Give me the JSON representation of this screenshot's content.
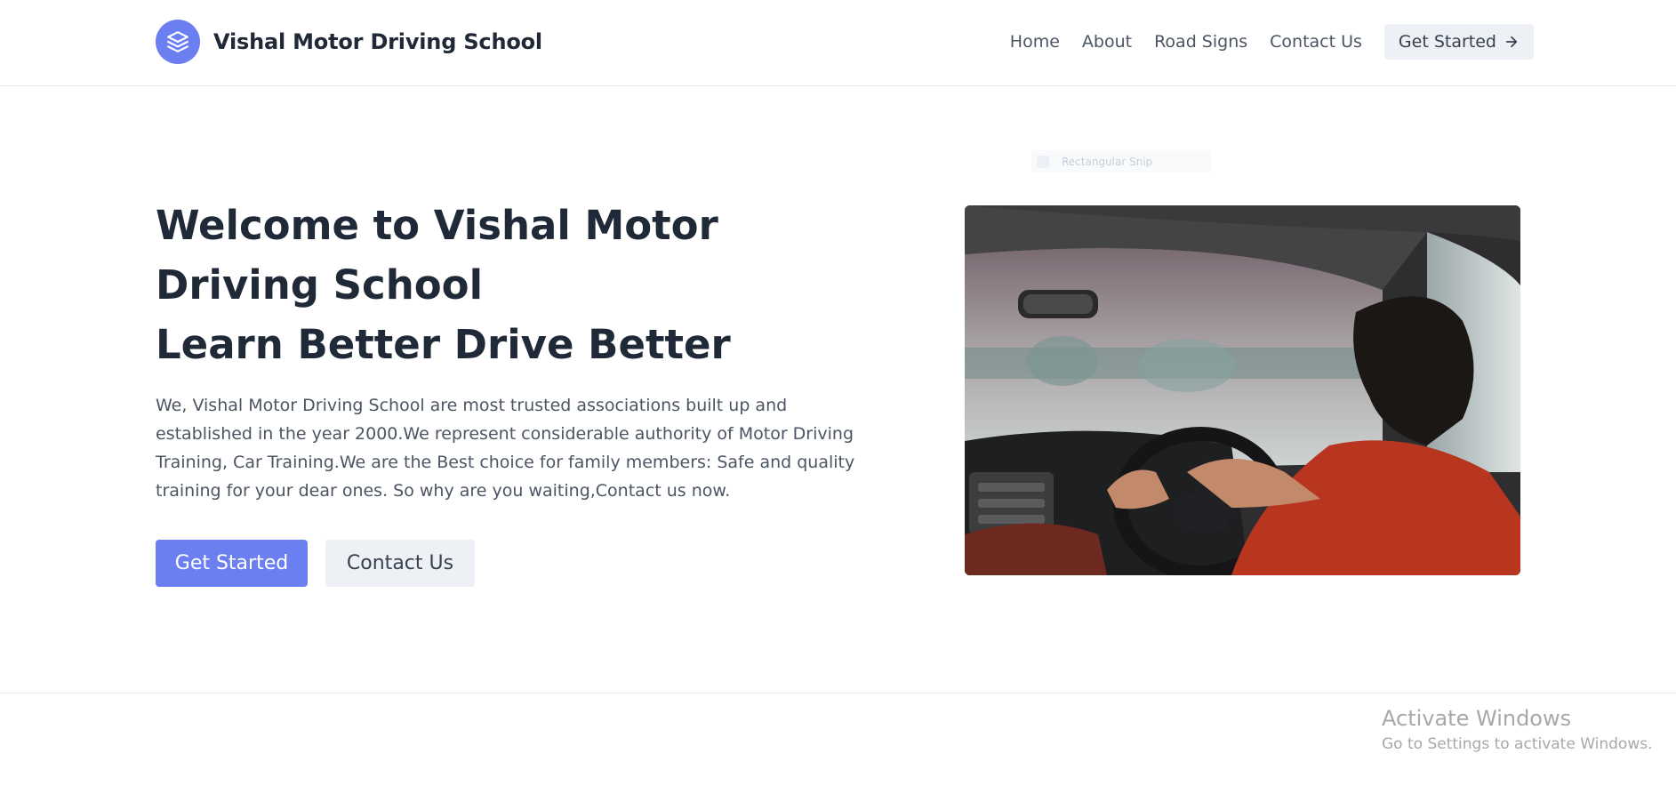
{
  "header": {
    "brand_name": "Vishal Motor Driving School",
    "logo_icon": "layers-icon",
    "nav": [
      {
        "label": "Home"
      },
      {
        "label": "About"
      },
      {
        "label": "Road Signs"
      },
      {
        "label": "Contact Us"
      }
    ],
    "cta_label": "Get Started",
    "cta_icon": "arrow-right-icon"
  },
  "ghost_tooltip": {
    "label": "Rectangular Snip"
  },
  "hero": {
    "title_line1": "Welcome to Vishal Motor Driving School",
    "title_line2": "Learn Better Drive Better",
    "description": "We, Vishal Motor Driving School are most trusted associations built up and established in the year 2000.We represent considerable authority of Motor Driving Training, Car Training.We are the Best choice for family members: Safe and quality training for your dear ones. So why are you waiting,Contact us now.",
    "primary_button": "Get Started",
    "secondary_button": "Contact Us",
    "image": "person-driving-car-photo"
  },
  "os_watermark": {
    "title": "Activate Windows",
    "subtitle": "Go to Settings to activate Windows."
  },
  "colors": {
    "accent": "#6b7ff0",
    "secondary_bg": "#edf0f5",
    "heading": "#1f2937",
    "body_text": "#4b5563"
  }
}
